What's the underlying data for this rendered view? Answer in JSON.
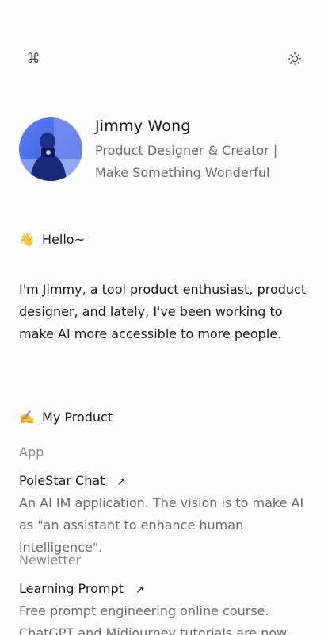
{
  "toolbar": {
    "command_icon": "command-icon",
    "theme_icon": "sun-icon"
  },
  "profile": {
    "name": "Jimmy Wong",
    "tagline": "Product Designer & Creator | Make Something Wonderful"
  },
  "hello": {
    "emoji": "👋",
    "text": "Hello~"
  },
  "intro": "I'm Jimmy, a tool product enthusiast, product designer, and lately, I've been working to make AI more accessible to more people.",
  "my_product": {
    "emoji": "✍️",
    "title": "My Product",
    "groups": [
      {
        "category": "App",
        "name": "PoleStar Chat",
        "link_icon": "arrow-up-right-icon",
        "description": "An AI IM application. The vision is to make AI as \"an assistant to enhance human intelligence\"."
      },
      {
        "category": "Newletter",
        "name": "Learning Prompt",
        "link_icon": "arrow-up-right-icon",
        "description": "Free prompt engineering online course. ChatGPT and Midjourney tutorials are now"
      }
    ]
  },
  "colors": {
    "background": "#fcfcfc",
    "text": "#1a1a1a",
    "muted": "#6b6b6b",
    "avatar_tint": "#3a5cf0"
  }
}
